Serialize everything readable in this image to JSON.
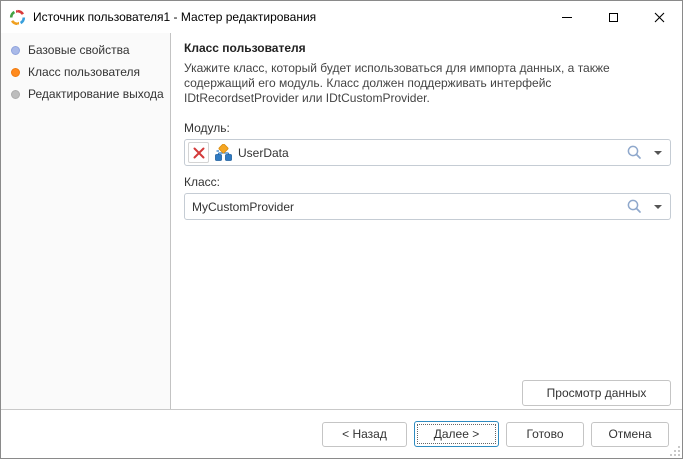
{
  "window": {
    "title": "Источник пользователя1 - Мастер редактирования"
  },
  "icons": {
    "app": "circular-colored-arrows",
    "minimize": "dash",
    "maximize": "square-outline",
    "close": "x-cross",
    "clear": "red-x",
    "module": "flowchart-hierarchy",
    "search": "magnifier",
    "dropdown": "down-triangle",
    "resize_grip": "diagonal-dots"
  },
  "sidebar": {
    "steps": [
      {
        "label": "Базовые свойства",
        "state": "done"
      },
      {
        "label": "Класс пользователя",
        "state": "current"
      },
      {
        "label": "Редактирование выхода",
        "state": "pending"
      }
    ]
  },
  "content": {
    "heading": "Класс пользователя",
    "description": "Укажите класс, который будет использоваться для импорта данных, а также содержащий его модуль. Класс должен поддерживать интерфейс IDtRecordsetProvider или IDtCustomProvider.",
    "module_field": {
      "label": "Модуль:",
      "value": "UserData"
    },
    "class_field": {
      "label": "Класс:",
      "value": "MyCustomProvider"
    },
    "preview_button_label": "Просмотр данных"
  },
  "footer": {
    "back_label": "< Назад",
    "next_label": "Далее >",
    "finish_label": "Готово",
    "cancel_label": "Отмена"
  },
  "colors": {
    "step_done_dot": "#a9b9e8",
    "step_current_dot": "#ff8a1e",
    "step_pending_dot": "#bdbdbd",
    "field_border": "#c5ccd4",
    "focused_button_border": "#2e8bc0",
    "clear_x": "#d33a3a",
    "module_icon_orange": "#f5a623",
    "module_icon_blue": "#2f7bc3",
    "search_icon": "#8fa8cc"
  }
}
